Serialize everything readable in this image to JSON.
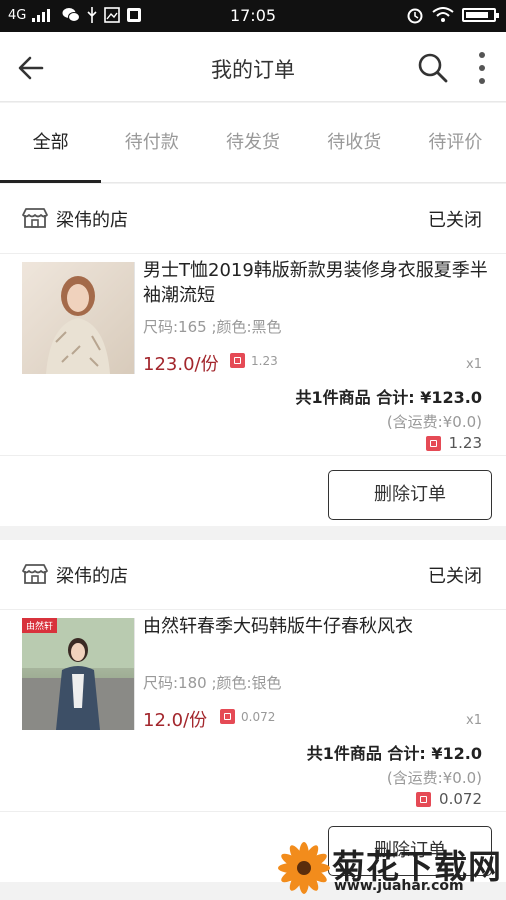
{
  "status_bar": {
    "network": "4G",
    "time": "17:05"
  },
  "app_bar": {
    "title": "我的订单"
  },
  "tabs": [
    {
      "label": "全部",
      "active": true
    },
    {
      "label": "待付款",
      "active": false
    },
    {
      "label": "待发货",
      "active": false
    },
    {
      "label": "待收货",
      "active": false
    },
    {
      "label": "待评价",
      "active": false
    }
  ],
  "orders": [
    {
      "shop_name": "梁伟的店",
      "status": "已关闭",
      "product_name": "男士T恤2019韩版新款男装修身衣服夏季半袖潮流短",
      "sku": "尺码:165 ;颜色:黑色",
      "price": "123.0/份",
      "points": "1.23",
      "quantity": "x1",
      "summary_count": "共1件商品",
      "summary_total_label": "合计:",
      "summary_total": "¥123.0",
      "shipping": "(含运费:¥0.0)",
      "summary_points": "1.23",
      "action_label": "删除订单"
    },
    {
      "shop_name": "梁伟的店",
      "status": "已关闭",
      "product_name": "由然轩春季大码韩版牛仔春秋风衣",
      "product_badge": "由然轩",
      "sku": "尺码:180 ;颜色:银色",
      "price": "12.0/份",
      "points": "0.072",
      "quantity": "x1",
      "summary_count": "共1件商品",
      "summary_total_label": "合计:",
      "summary_total": "¥12.0",
      "shipping": "(含运费:¥0.0)",
      "summary_points": "0.072",
      "action_label": "删除订单"
    }
  ],
  "watermark": {
    "title": "菊花下载网",
    "url": "www.juahar.com"
  },
  "colors": {
    "price_red": "#a3272d",
    "points_red": "#e54a55",
    "status_bar_bg": "#111111"
  }
}
